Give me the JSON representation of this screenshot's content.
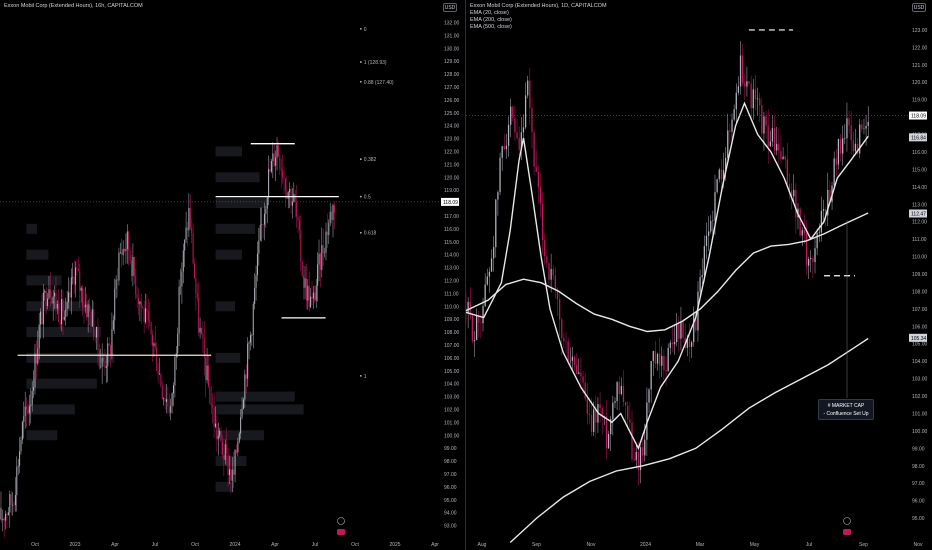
{
  "left_header": {
    "title": "Exxon Mobil Corp (Extended Hours), 16h, CAPITALCOM"
  },
  "right_header": {
    "title": "Exxon Mobil Corp (Extended Hours), 1D, CAPITALCOM",
    "indicators": [
      "EMA (20, close)",
      "EMA (200, close)",
      "EMA (500, close)"
    ]
  },
  "currency_label": "USD",
  "callout": {
    "line1": "# MARKET CAP",
    "line2": "- Confluence Set Up"
  },
  "colors": {
    "background": "#000000",
    "candle_up": "#b2b5be",
    "candle_down": "#c2185b",
    "ema": "#e8e8e8",
    "level_line": "#ffffff",
    "pole_line": "#f5e6c8",
    "axis_text": "#b2b5be",
    "price_tag": "#ffffff"
  },
  "chart_data": [
    {
      "type": "candlestick",
      "panel": "left",
      "title": "Exxon Mobil Corp (Extended Hours), 16h, CAPITALCOM",
      "x_ticks": [
        "Oct",
        "2023",
        "Apr",
        "Jul",
        "Oct",
        "2024",
        "Apr",
        "Jul",
        "Oct",
        "2025",
        "Apr"
      ],
      "y_ticks": [
        132,
        131,
        130,
        129,
        128,
        127,
        126,
        125,
        124,
        123,
        122,
        121,
        120,
        119,
        118,
        117,
        116,
        115,
        114,
        113,
        112,
        111,
        110,
        109,
        108,
        107,
        106,
        105,
        104,
        103,
        102,
        101,
        100,
        99,
        98,
        97,
        96,
        95,
        94,
        93
      ],
      "ylim": [
        92.5,
        132.5
      ],
      "last_price": "118.09",
      "price_path": [
        [
          0.0,
          93.5
        ],
        [
          0.03,
          95.0
        ],
        [
          0.05,
          100.5
        ],
        [
          0.07,
          103.0
        ],
        [
          0.09,
          108.5
        ],
        [
          0.11,
          112.0
        ],
        [
          0.13,
          110.0
        ],
        [
          0.15,
          109.0
        ],
        [
          0.17,
          113.0
        ],
        [
          0.19,
          110.5
        ],
        [
          0.21,
          109.0
        ],
        [
          0.23,
          105.5
        ],
        [
          0.25,
          106.5
        ],
        [
          0.27,
          114.0
        ],
        [
          0.29,
          115.0
        ],
        [
          0.31,
          111.5
        ],
        [
          0.33,
          109.0
        ],
        [
          0.35,
          107.0
        ],
        [
          0.37,
          103.5
        ],
        [
          0.39,
          102.0
        ],
        [
          0.41,
          112.0
        ],
        [
          0.43,
          117.5
        ],
        [
          0.45,
          109.0
        ],
        [
          0.47,
          104.5
        ],
        [
          0.49,
          100.5
        ],
        [
          0.51,
          98.5
        ],
        [
          0.53,
          96.5
        ],
        [
          0.55,
          103.0
        ],
        [
          0.57,
          108.0
        ],
        [
          0.59,
          115.0
        ],
        [
          0.61,
          120.0
        ],
        [
          0.63,
          122.5
        ],
        [
          0.65,
          119.5
        ],
        [
          0.67,
          118.0
        ],
        [
          0.69,
          112.0
        ],
        [
          0.71,
          110.0
        ],
        [
          0.73,
          114.0
        ],
        [
          0.75,
          117.0
        ],
        [
          0.76,
          118.0
        ]
      ],
      "volume_profiles": [
        {
          "x_start": 0.06,
          "rows": [
            [
              112,
              0.4
            ],
            [
              110,
              0.7
            ],
            [
              108,
              0.85
            ],
            [
              106,
              1.0
            ],
            [
              104,
              0.8
            ],
            [
              102,
              0.55
            ],
            [
              100,
              0.35
            ],
            [
              114,
              0.25
            ],
            [
              116,
              0.12
            ]
          ]
        },
        {
          "x_start": 0.49,
          "rows": [
            [
              122,
              0.3
            ],
            [
              120,
              0.5
            ],
            [
              118,
              0.6
            ],
            [
              116,
              0.45
            ],
            [
              114,
              0.3
            ],
            [
              110,
              0.22
            ],
            [
              106,
              0.28
            ],
            [
              103,
              0.9
            ],
            [
              102,
              1.0
            ],
            [
              100,
              0.55
            ],
            [
              98,
              0.35
            ],
            [
              96,
              0.2
            ]
          ]
        }
      ],
      "fib_levels": [
        {
          "label": "0",
          "price": 131.5
        },
        {
          "label": "1 (128.93)",
          "price": 128.93
        },
        {
          "label": "0.88 (127.40)",
          "price": 127.4
        },
        {
          "label": "0.382",
          "price": 121.4
        },
        {
          "label": "0.5",
          "price": 118.5
        },
        {
          "label": "0.618",
          "price": 115.7
        },
        {
          "label": "1",
          "price": 104.6
        }
      ],
      "horizontal_lines": [
        {
          "price": 106.2,
          "x_from": 0.04,
          "x_to": 0.48
        },
        {
          "price": 118.5,
          "x_from": 0.49,
          "x_to": 0.77
        },
        {
          "price": 122.6,
          "x_from": 0.57,
          "x_to": 0.67
        },
        {
          "price": 109.1,
          "x_from": 0.64,
          "x_to": 0.74
        }
      ]
    },
    {
      "type": "candlestick",
      "panel": "right",
      "title": "Exxon Mobil Corp (Extended Hours), 1D, CAPITALCOM",
      "x_ticks": [
        "Aug",
        "Sep",
        "Nov",
        "2024",
        "Mar",
        "May",
        "Jul",
        "Sep",
        "Nov"
      ],
      "y_ticks": [
        123,
        122,
        121,
        120,
        119,
        118,
        117,
        116,
        115,
        114,
        113,
        112,
        111,
        110,
        109,
        108,
        107,
        106,
        105,
        104,
        103,
        102,
        101,
        100,
        99,
        98,
        97,
        96,
        95
      ],
      "ylim": [
        94.2,
        123.8
      ],
      "last_price": "118.09",
      "price_tags": [
        "118.09",
        "116.84",
        "112.47",
        "105.34"
      ],
      "price_path": [
        [
          0.0,
          107.0
        ],
        [
          0.02,
          105.5
        ],
        [
          0.04,
          107.5
        ],
        [
          0.06,
          110.5
        ],
        [
          0.08,
          116.0
        ],
        [
          0.1,
          118.0
        ],
        [
          0.12,
          115.5
        ],
        [
          0.14,
          119.5
        ],
        [
          0.16,
          114.0
        ],
        [
          0.18,
          110.0
        ],
        [
          0.2,
          108.0
        ],
        [
          0.22,
          105.0
        ],
        [
          0.24,
          104.0
        ],
        [
          0.26,
          103.0
        ],
        [
          0.28,
          100.0
        ],
        [
          0.3,
          101.5
        ],
        [
          0.32,
          99.5
        ],
        [
          0.34,
          103.0
        ],
        [
          0.36,
          102.0
        ],
        [
          0.38,
          98.0
        ],
        [
          0.4,
          99.0
        ],
        [
          0.42,
          104.0
        ],
        [
          0.44,
          103.5
        ],
        [
          0.46,
          104.5
        ],
        [
          0.48,
          106.0
        ],
        [
          0.5,
          105.0
        ],
        [
          0.52,
          106.5
        ],
        [
          0.54,
          110.0
        ],
        [
          0.56,
          113.0
        ],
        [
          0.58,
          115.5
        ],
        [
          0.6,
          117.5
        ],
        [
          0.62,
          121.0
        ],
        [
          0.64,
          119.5
        ],
        [
          0.66,
          118.5
        ],
        [
          0.68,
          117.0
        ],
        [
          0.7,
          116.5
        ],
        [
          0.72,
          115.0
        ],
        [
          0.74,
          113.5
        ],
        [
          0.76,
          111.0
        ],
        [
          0.78,
          109.5
        ],
        [
          0.8,
          112.0
        ],
        [
          0.82,
          113.5
        ],
        [
          0.84,
          116.0
        ],
        [
          0.86,
          117.5
        ],
        [
          0.88,
          116.0
        ],
        [
          0.9,
          118.0
        ],
        [
          0.91,
          117.0
        ]
      ],
      "ema_20": [
        [
          0.0,
          106.8
        ],
        [
          0.04,
          106.5
        ],
        [
          0.08,
          108.5
        ],
        [
          0.1,
          111.5
        ],
        [
          0.12,
          115.5
        ],
        [
          0.13,
          116.8
        ],
        [
          0.15,
          113.5
        ],
        [
          0.17,
          110.0
        ],
        [
          0.19,
          107.0
        ],
        [
          0.22,
          104.5
        ],
        [
          0.26,
          102.5
        ],
        [
          0.3,
          101.0
        ],
        [
          0.33,
          100.5
        ],
        [
          0.35,
          101.0
        ],
        [
          0.37,
          100.0
        ],
        [
          0.39,
          99.0
        ],
        [
          0.41,
          100.5
        ],
        [
          0.44,
          102.5
        ],
        [
          0.48,
          104.0
        ],
        [
          0.52,
          106.5
        ],
        [
          0.55,
          110.0
        ],
        [
          0.58,
          114.0
        ],
        [
          0.61,
          117.5
        ],
        [
          0.63,
          118.8
        ],
        [
          0.66,
          117.0
        ],
        [
          0.69,
          116.0
        ],
        [
          0.72,
          114.5
        ],
        [
          0.75,
          112.5
        ],
        [
          0.78,
          111.0
        ],
        [
          0.81,
          112.0
        ],
        [
          0.84,
          114.5
        ],
        [
          0.87,
          115.5
        ],
        [
          0.91,
          116.9
        ]
      ],
      "ema_200": [
        [
          0.0,
          106.9
        ],
        [
          0.05,
          107.5
        ],
        [
          0.09,
          108.4
        ],
        [
          0.13,
          108.7
        ],
        [
          0.17,
          108.5
        ],
        [
          0.21,
          108.0
        ],
        [
          0.25,
          107.3
        ],
        [
          0.29,
          106.7
        ],
        [
          0.33,
          106.4
        ],
        [
          0.37,
          106.0
        ],
        [
          0.41,
          105.7
        ],
        [
          0.45,
          105.8
        ],
        [
          0.49,
          106.3
        ],
        [
          0.53,
          107.0
        ],
        [
          0.57,
          108.0
        ],
        [
          0.61,
          109.2
        ],
        [
          0.65,
          110.2
        ],
        [
          0.69,
          110.6
        ],
        [
          0.73,
          110.7
        ],
        [
          0.77,
          110.9
        ],
        [
          0.81,
          111.3
        ],
        [
          0.85,
          111.8
        ],
        [
          0.91,
          112.5
        ]
      ],
      "ema_500": [
        [
          0.1,
          93.6
        ],
        [
          0.16,
          95.0
        ],
        [
          0.22,
          96.2
        ],
        [
          0.28,
          97.1
        ],
        [
          0.34,
          97.7
        ],
        [
          0.4,
          98.0
        ],
        [
          0.46,
          98.4
        ],
        [
          0.52,
          99.0
        ],
        [
          0.58,
          100.1
        ],
        [
          0.64,
          101.3
        ],
        [
          0.7,
          102.2
        ],
        [
          0.76,
          103.0
        ],
        [
          0.82,
          103.8
        ],
        [
          0.88,
          104.8
        ],
        [
          0.91,
          105.3
        ]
      ],
      "dashed_lines": [
        {
          "price": 123.0,
          "x_from": 0.64,
          "x_to": 0.74
        },
        {
          "price": 108.9,
          "x_from": 0.81,
          "x_to": 0.88
        }
      ]
    }
  ]
}
